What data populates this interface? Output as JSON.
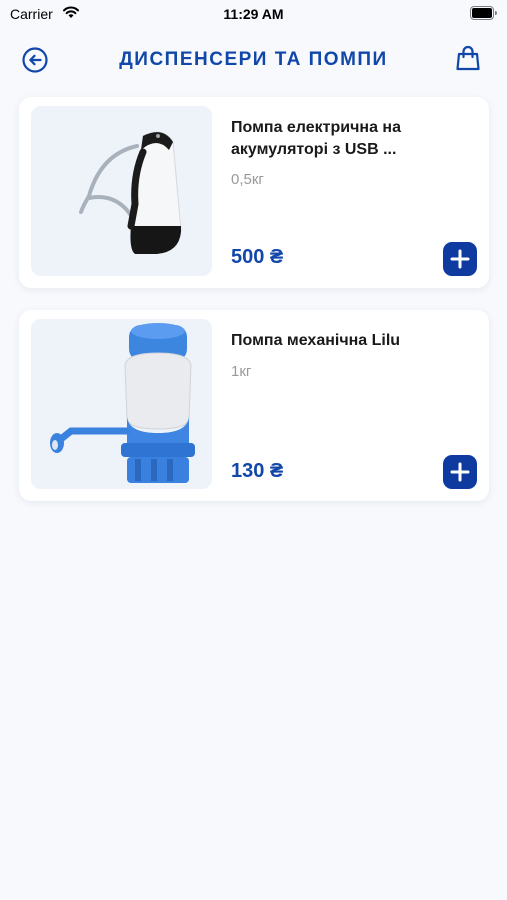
{
  "status_bar": {
    "carrier": "Carrier",
    "time": "11:29 AM"
  },
  "header": {
    "title": "ДИСПЕНСЕРИ ТА ПОМПИ",
    "back_icon": "arrow-left-circle-icon",
    "cart_icon": "shopping-bag-icon"
  },
  "colors": {
    "accent": "#1147a8",
    "button": "#0f3aa0",
    "background": "#f7f9fd"
  },
  "products": [
    {
      "name": "Помпа електрична на акумуляторі з USB ...",
      "weight": "0,5кг",
      "price": "500 ₴",
      "image": "electric-water-pump-image"
    },
    {
      "name": "Помпа механічна Lilu",
      "weight": "1кг",
      "price": "130 ₴",
      "image": "mechanical-water-pump-image"
    }
  ]
}
